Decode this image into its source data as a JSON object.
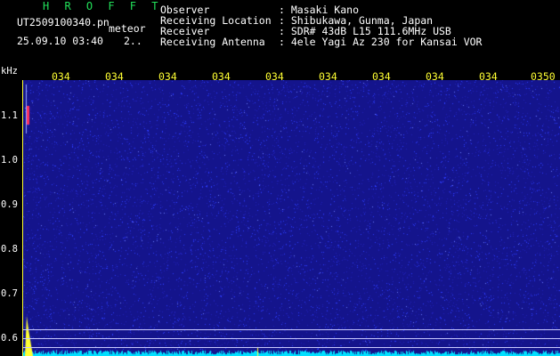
{
  "header": {
    "title": "H R O F F T",
    "filename": "UT2509100340.pn",
    "type": "meteor",
    "datetime": "25.09.10 03:40",
    "count": "2..",
    "fields": [
      {
        "label": "Observer",
        "value": ": Masaki Kano"
      },
      {
        "label": "Receiving Location",
        "value": ": Shibukawa, Gunma, Japan"
      },
      {
        "label": "Receiver",
        "value": ": SDR# 43dB L15 111.6MHz USB"
      },
      {
        "label": "Receiving Antenna",
        "value": ": 4ele Yagi Az 230 for Kansai VOR"
      }
    ]
  },
  "axes": {
    "y_unit": "kHz",
    "y_ticks": [
      "1.1",
      "1.0",
      "0.9",
      "0.8",
      "0.7",
      "0.6"
    ],
    "x_ticks": [
      "034",
      "034",
      "034",
      "034",
      "034",
      "034",
      "034",
      "034",
      "034",
      "0350"
    ]
  },
  "colors": {
    "background": "#14148c",
    "noise": "#2c3cff",
    "echo": "#ff3060",
    "spike": "#ffff33",
    "baseline": "#00e0ff"
  }
}
